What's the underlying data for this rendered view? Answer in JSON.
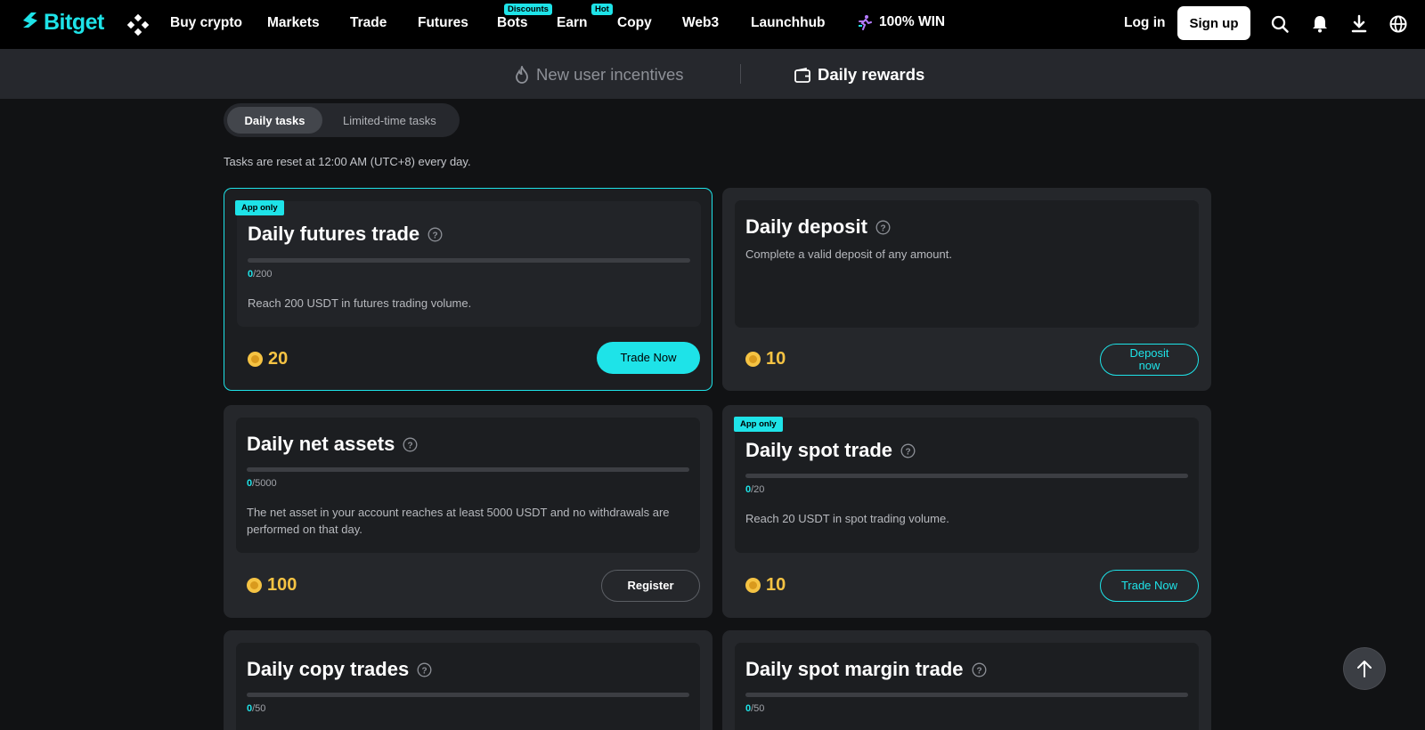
{
  "brand": {
    "name": "Bitget",
    "accent": "#1ee3e8",
    "coin_color": "#f5c343"
  },
  "nav": {
    "items": [
      {
        "label": "Buy crypto"
      },
      {
        "label": "Markets"
      },
      {
        "label": "Trade"
      },
      {
        "label": "Futures"
      },
      {
        "label": "Bots",
        "badge": "Discounts"
      },
      {
        "label": "Earn",
        "badge": "Hot"
      },
      {
        "label": "Copy"
      },
      {
        "label": "Web3"
      },
      {
        "label": "Launchhub"
      }
    ],
    "promo": "100% WIN",
    "login": "Log in",
    "signup": "Sign up",
    "icons": [
      "grid-icon",
      "search-icon",
      "bell-icon",
      "download-icon",
      "globe-icon"
    ]
  },
  "subnav": {
    "incentives": "New user incentives",
    "daily_rewards": "Daily rewards"
  },
  "tabs": {
    "daily": "Daily tasks",
    "limited": "Limited-time tasks"
  },
  "reset_note": "Tasks are reset at 12:00 AM (UTC+8) every day.",
  "app_only_label": "App only",
  "tasks": [
    {
      "title": "Daily futures trade",
      "current": "0",
      "target": "/200",
      "progress": 0,
      "desc": "Reach 200 USDT in futures trading volume.",
      "reward": "20",
      "button": "Trade Now",
      "app_only": true
    },
    {
      "title": "Daily deposit",
      "desc": "Complete a valid deposit of any amount.",
      "reward": "10",
      "button": "Deposit now",
      "app_only": false
    },
    {
      "title": "Daily net assets",
      "current": "0",
      "target": "/5000",
      "progress": 0,
      "desc": "The net asset in your account reaches at least 5000 USDT and no withdrawals are performed on that day.",
      "reward": "100",
      "button": "Register",
      "app_only": false
    },
    {
      "title": "Daily spot trade",
      "current": "0",
      "target": "/20",
      "progress": 0,
      "desc": "Reach 20 USDT in spot trading volume.",
      "reward": "10",
      "button": "Trade Now",
      "app_only": true
    },
    {
      "title": "Daily copy trades",
      "current": "0",
      "target": "/50",
      "progress": 0
    },
    {
      "title": "Daily spot margin trade",
      "current": "0",
      "target": "/50",
      "progress": 0
    }
  ]
}
